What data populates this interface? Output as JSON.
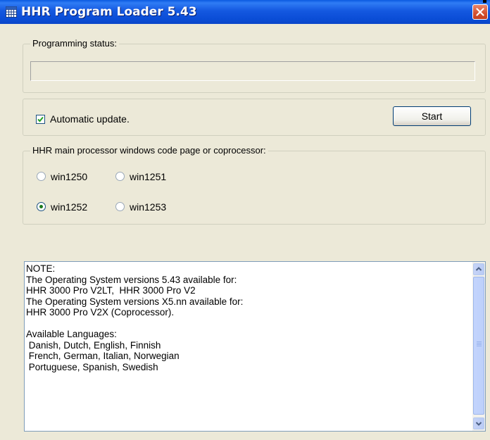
{
  "window": {
    "title": "HHR Program Loader 5.43",
    "icons": {
      "app": "grid-app-icon",
      "close": "close-icon"
    }
  },
  "programming_status": {
    "legend": "Programming status:",
    "value": ""
  },
  "update": {
    "checkbox_label": "Automatic update.",
    "checked": true,
    "start_label": "Start"
  },
  "code_page": {
    "legend": "HHR main processor windows code page or coprocessor:",
    "options": [
      {
        "label": "win1250",
        "selected": false
      },
      {
        "label": "win1251",
        "selected": false
      },
      {
        "label": "win1252",
        "selected": true
      },
      {
        "label": "win1253",
        "selected": false
      }
    ]
  },
  "notes": {
    "text": "NOTE:\nThe Operating System versions 5.43 available for:\nHHR 3000 Pro V2LT,  HHR 3000 Pro V2\nThe Operating System versions X5.nn available for:\nHHR 3000 Pro V2X (Coprocessor).\n\nAvailable Languages:\n Danish, Dutch, English, Finnish\n French, German, Italian, Norwegian\n Portuguese, Spanish, Swedish"
  },
  "colors": {
    "titlebar": "#0a4dd6",
    "dialog_bg": "#ece9d8",
    "close_button": "#d4502e",
    "scrollbar": "#c3d4fd"
  }
}
